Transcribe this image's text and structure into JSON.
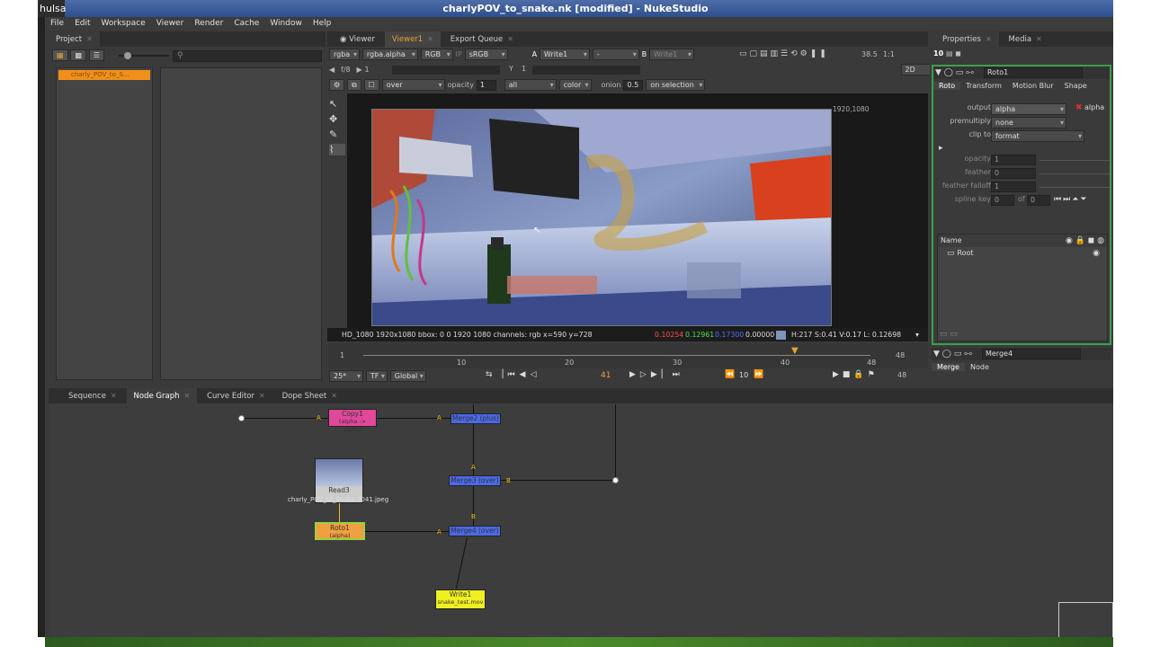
{
  "window": {
    "title": "charlyPOV_to_snake.nk [modified] - NukeStudio",
    "left_label": "hulsa"
  },
  "menu": [
    "File",
    "Edit",
    "Workspace",
    "Viewer",
    "Render",
    "Cache",
    "Window",
    "Help"
  ],
  "project": {
    "tabs": [
      "Project"
    ],
    "item": "charly_POV_to_S..."
  },
  "viewer": {
    "tabs": [
      "Viewer",
      "Viewer1",
      "Export Queue"
    ],
    "channels": "rgba",
    "alpha": "rgba.alpha",
    "rgb": "RGB",
    "ip": "IP",
    "lut": "sRGB",
    "a_input": "Write1",
    "a_label": "A",
    "b_label": "B",
    "b_input": "Write1",
    "dash": "-",
    "zoom": "38.5",
    "ratio": "1:1",
    "frame_label": "f/8",
    "frame_val": "1",
    "y_label": "Y",
    "y_val": "1",
    "mode2d": "2D",
    "comp": "over",
    "opacity_label": "opacity",
    "opacity": "1",
    "all": "all",
    "color": "color",
    "onion_label": "onion",
    "onion": "0.5",
    "on_selection": "on selection",
    "res_label": "1920,1080",
    "status": {
      "format": "HD_1080 1920x1080  bbox: 0 0 1920 1080 channels: rgb  x=590 y=728",
      "r": "0.10254",
      "g": "0.12961",
      "b": "0.17300",
      "a": "0.00000",
      "hsl": "H:217 S:0.41 V:0.17  L: 0.12698"
    },
    "timeline": {
      "start": "1",
      "ticks": [
        "10",
        "20",
        "30",
        "40",
        "48"
      ],
      "end": "48",
      "current": "41",
      "fps": "25*",
      "tf": "TF",
      "global": "Global",
      "step": "10",
      "end2": "48"
    }
  },
  "properties": {
    "tabs": [
      "Properties",
      "Media"
    ],
    "count": "10",
    "node_name": "Roto1",
    "subtabs": [
      "Roto",
      "Transform",
      "Motion Blur",
      "Shape"
    ],
    "output_label": "output",
    "output": "alpha",
    "alpha_chk": "alpha",
    "premult_label": "premultiply",
    "premult": "none",
    "clip_label": "clip to",
    "clip": "format",
    "opacity_label": "opacity",
    "opacity": "1",
    "feather_label": "feather",
    "feather": "0",
    "falloff_label": "feather falloff",
    "falloff": "1",
    "spline_label": "spline key",
    "spline": "0",
    "of": "of",
    "spline_of": "0",
    "tree_header": "Name",
    "tree_root": "Root",
    "merge_name": "Merge4",
    "merge_tabs": [
      "Merge",
      "Node"
    ]
  },
  "graph": {
    "tabs": [
      "Sequence",
      "Node Graph",
      "Curve Editor",
      "Dope Sheet"
    ],
    "nodes": {
      "copy1": {
        "title": "Copy1",
        "sub": "(alpha -> alpha)"
      },
      "merge2": {
        "title": "Merge2 (plus)"
      },
      "merge3": {
        "title": "Merge3 (over)"
      },
      "merge4": {
        "title": "Merge4 (over)"
      },
      "read3": {
        "title": "Read3",
        "sub": "charly_POV_to_Snake.0041.jpeg"
      },
      "roto1": {
        "title": "Roto1",
        "sub": "(alpha)"
      },
      "write1": {
        "title": "Write1",
        "sub": "snake_test.mov"
      }
    },
    "labels": {
      "A": "A",
      "B": "B"
    }
  }
}
